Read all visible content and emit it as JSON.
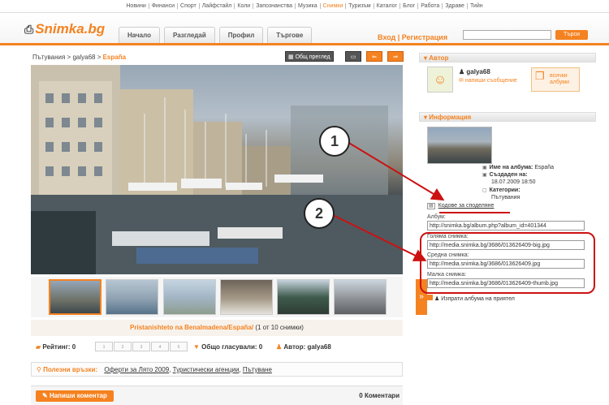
{
  "topnav": [
    "Новини",
    "Финанси",
    "Спорт",
    "Лайфстайл",
    "Коли",
    "Запознанства",
    "Музика",
    "Снимки",
    "Туризъм",
    "Каталог",
    "Блог",
    "Работа",
    "Здраве",
    "Тийн"
  ],
  "topnav_active": "Снимки",
  "logo": "Snimka.bg",
  "tabs": [
    "Начало",
    "Разгледай",
    "Профил",
    "Търгове"
  ],
  "login": "Вход | Регистрация",
  "search": {
    "value": "",
    "button": "Търси"
  },
  "breadcrumb": {
    "path": "Пътувания > galya68 > ",
    "current": "España"
  },
  "controls": {
    "overview": "Общ преглед",
    "prev": "⇐",
    "next": "⇒"
  },
  "thumbs_more": "»",
  "caption": {
    "title": "Pristanishteto na Benalmadena/España/",
    "count": "(1 от 10 снимки)"
  },
  "rating": {
    "label": "Рейтинг: 0",
    "stars": [
      "1",
      "2",
      "3",
      "4",
      "5"
    ],
    "votes": "Общо гласували: 0",
    "author": "Автор: galya68"
  },
  "useful_links": {
    "label": "Полезни връзки:",
    "links": [
      "Оферти за Лято 2009",
      "Туристически агенции",
      "Пътуване"
    ]
  },
  "comments": {
    "button": "Напиши коментар",
    "count": "0 Коментари"
  },
  "author_panel": {
    "heading": "Автор",
    "name": "galya68",
    "message": "напиши съобщение",
    "albums": "всички албуми"
  },
  "info_panel": {
    "heading": "Информация",
    "album_name_label": "Име на албума:",
    "album_name": "España",
    "created_label": "Създаден на:",
    "created": "18.07.2009 18:50",
    "category_label": "Категории:",
    "category": "Пътувания"
  },
  "share": {
    "link": "Кодове за споделяне",
    "album_label": "Албум:",
    "album_code": "http://snimka.bg/album.php?album_id=401344",
    "big_label": "Голяма снимка:",
    "big_code": "http://media.snimka.bg/3686/013626409-big.jpg",
    "medium_label": "Средна снимка:",
    "medium_code": "http://media.snimka.bg/3686/013626409.jpg",
    "small_label": "Малка снимка:",
    "small_code": "http://media.snimka.bg/3686/013626409-thumb.jpg"
  },
  "send_friend": "Изпрати албума на приятел",
  "annotations": [
    "1",
    "2"
  ],
  "colors": {
    "accent": "#f58220",
    "annotation_red": "#cc1111"
  }
}
